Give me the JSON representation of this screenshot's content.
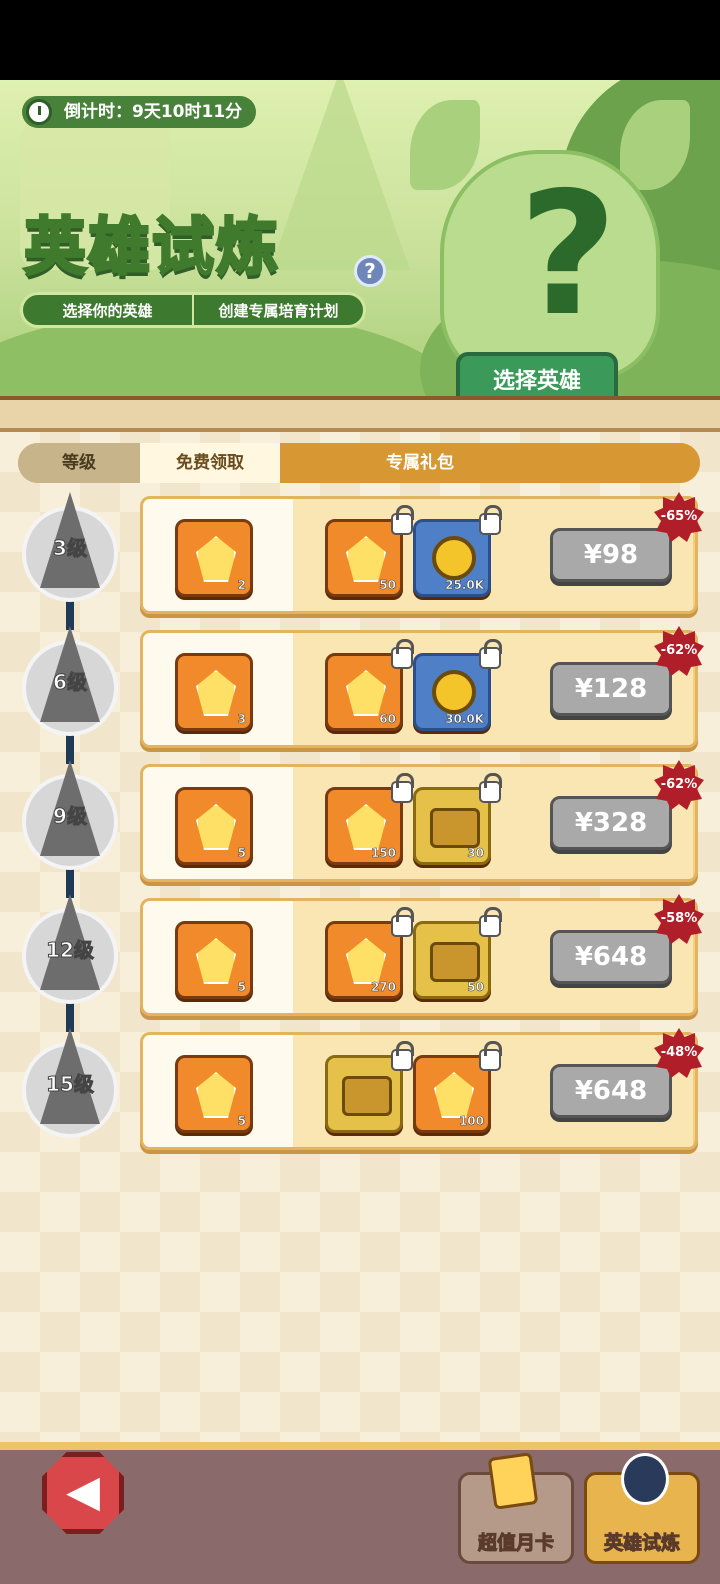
{
  "timer": {
    "label": "倒计时：9天10时11分"
  },
  "header": {
    "title": "英雄试炼",
    "sub_left": "选择你的英雄",
    "sub_right": "创建专属培育计划",
    "help": "?",
    "pick_button": "选择英雄",
    "mystery": "?"
  },
  "tabs": {
    "level": "等级",
    "free": "免费领取",
    "paid": "专属礼包"
  },
  "rows": [
    {
      "level": "3级",
      "free_count": "2",
      "paid": [
        {
          "type": "gem",
          "count": "50"
        },
        {
          "type": "coin",
          "count": "25.0K"
        }
      ],
      "price": "¥98",
      "discount": "-65%"
    },
    {
      "level": "6级",
      "free_count": "3",
      "paid": [
        {
          "type": "gem",
          "count": "60"
        },
        {
          "type": "coin",
          "count": "30.0K"
        }
      ],
      "price": "¥128",
      "discount": "-62%"
    },
    {
      "level": "9级",
      "free_count": "5",
      "paid": [
        {
          "type": "gem",
          "count": "150"
        },
        {
          "type": "chest",
          "count": "30"
        }
      ],
      "price": "¥328",
      "discount": "-62%"
    },
    {
      "level": "12级",
      "free_count": "5",
      "paid": [
        {
          "type": "gem",
          "count": "270"
        },
        {
          "type": "chest",
          "count": "50"
        }
      ],
      "price": "¥648",
      "discount": "-58%"
    },
    {
      "level": "15级",
      "free_count": "5",
      "paid": [
        {
          "type": "chest",
          "count": ""
        },
        {
          "type": "gem",
          "count": "100"
        }
      ],
      "price": "¥648",
      "discount": "-48%"
    }
  ],
  "nav": {
    "back": "◀",
    "monthly_card": "超值月卡",
    "hero_trial": "英雄试炼"
  },
  "colors": {
    "accent": "#d79834",
    "price_gray": "#a9a9a9",
    "discount_red": "#b01e2a",
    "green": "#3b9a5a"
  }
}
